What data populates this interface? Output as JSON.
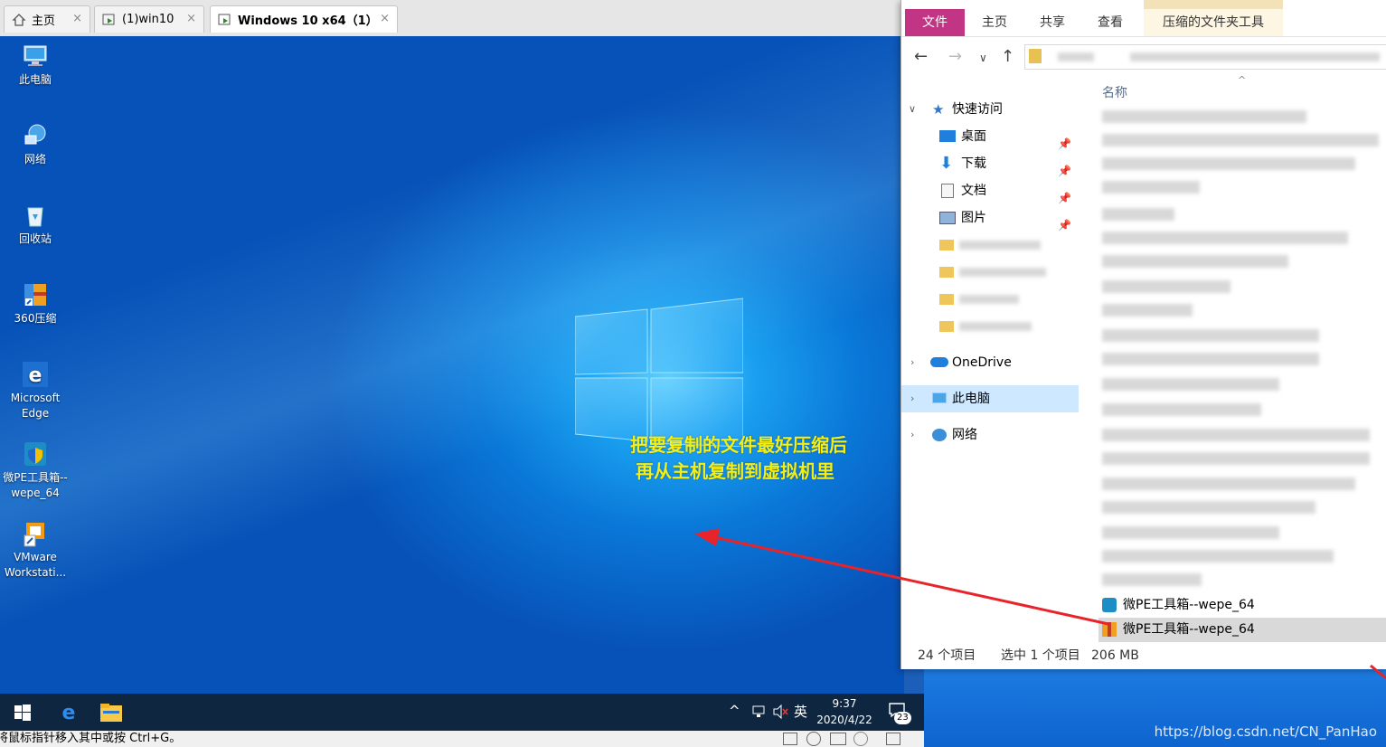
{
  "tabs": [
    {
      "label": "主页",
      "icon": "home-icon",
      "close": "×"
    },
    {
      "label": "(1)win10",
      "icon": "vm-icon",
      "close": "×"
    },
    {
      "label": "Windows 10 x64（1）",
      "icon": "vm-icon",
      "close": "×"
    }
  ],
  "desktop_icons": [
    {
      "label": "此电脑",
      "icon": "computer-icon"
    },
    {
      "label": "网络",
      "icon": "network-icon"
    },
    {
      "label": "回收站",
      "icon": "recycle-bin-icon"
    },
    {
      "label": "360压缩",
      "icon": "archive-icon"
    },
    {
      "label": "Microsoft Edge",
      "icon": "edge-icon"
    },
    {
      "label": "微PE工具箱--wepe_64",
      "icon": "wepe-icon"
    },
    {
      "label": "VMware Workstati...",
      "icon": "vmware-icon"
    }
  ],
  "annotation": {
    "line1": "把要复制的文件最好压缩后",
    "line2": "再从主机复制到虚拟机里",
    "color": "#f4ee12"
  },
  "taskbar": {
    "time": "9:37",
    "date": "2020/4/22",
    "ime": "英",
    "notification_count": "23"
  },
  "vm_status": "将鼠标指针移入其中或按 Ctrl+G。",
  "explorer": {
    "ribbon_tabs": [
      "文件",
      "主页",
      "共享",
      "查看",
      "压缩的文件夹工具"
    ],
    "column_header": "名称",
    "nav": {
      "quick_access": "快速访问",
      "desktop": "桌面",
      "downloads": "下载",
      "documents": "文档",
      "pictures": "图片",
      "onedrive": "OneDrive",
      "this_pc": "此电脑",
      "network": "网络"
    },
    "visible_files": [
      {
        "name": "微PE工具箱--wepe_64",
        "icon": "wepe-icon"
      },
      {
        "name": "微PE工具箱--wepe_64",
        "icon": "zip-icon",
        "selected": true
      }
    ],
    "status": {
      "count": "24 个项目",
      "selected": "选中 1 个项目",
      "size": "206 MB"
    },
    "accent": "#c13584"
  },
  "watermark": "https://blog.csdn.net/CN_PanHao"
}
